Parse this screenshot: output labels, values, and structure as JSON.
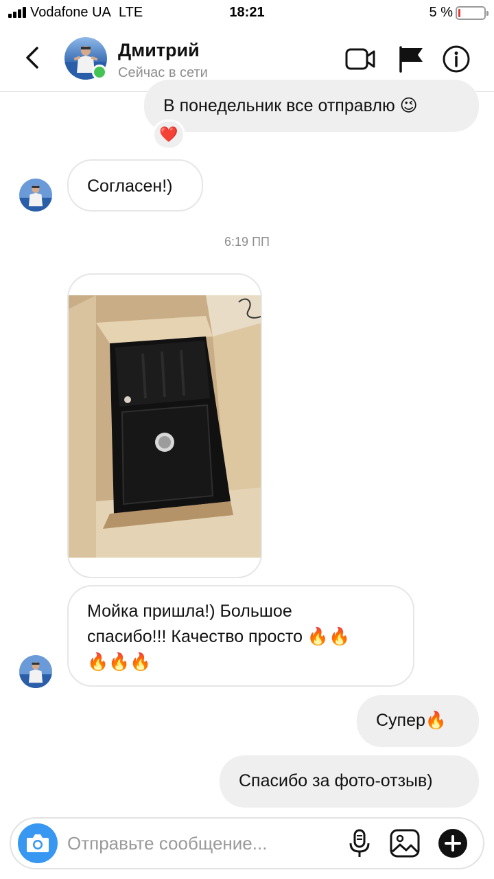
{
  "status_bar": {
    "carrier": "Vodafone UA",
    "network": "LTE",
    "time": "18:21",
    "battery_percent": "5 %"
  },
  "header": {
    "contact_name": "Дмитрий",
    "contact_status": "Сейчас в сети"
  },
  "messages": [
    {
      "from": "me",
      "text": "В понедельник все отправлю 😉",
      "reaction": "❤️"
    },
    {
      "from": "them",
      "text": "Согласен!)"
    },
    {
      "type": "timestamp",
      "text": "6:19 ПП"
    },
    {
      "from": "them",
      "type": "photo"
    },
    {
      "from": "them",
      "lines": [
        "Мойка пришла!) Большое",
        "спасибо!!! Качество просто 🔥🔥",
        "🔥🔥🔥"
      ]
    },
    {
      "from": "me",
      "text": "Супер🔥"
    },
    {
      "from": "me",
      "text": "Спасибо за фото-отзыв)"
    }
  ],
  "composer": {
    "placeholder": "Отправьте сообщение..."
  },
  "icons": {
    "back": "chevron-left-icon",
    "video": "video-camera-icon",
    "flag": "flag-icon",
    "info": "info-icon",
    "camera": "camera-icon",
    "mic": "microphone-icon",
    "gallery": "image-icon",
    "plus": "plus-icon"
  },
  "colors": {
    "online": "#44c553",
    "camera_button": "#3897f0",
    "outgoing_bubble": "#efefef"
  }
}
